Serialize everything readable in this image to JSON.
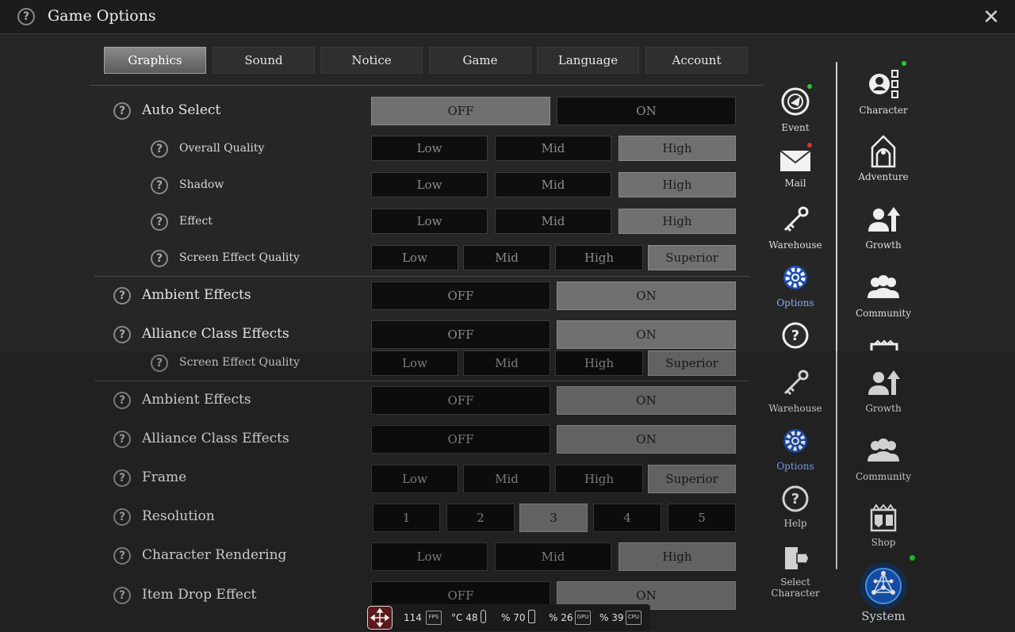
{
  "title": "Game Options",
  "tabs": [
    "Graphics",
    "Sound",
    "Notice",
    "Game",
    "Language",
    "Account"
  ],
  "active_tab": "Graphics",
  "options": {
    "auto_select": {
      "label": "Auto Select",
      "off": "OFF",
      "on": "ON"
    },
    "overall_quality": {
      "label": "Overall Quality",
      "low": "Low",
      "mid": "Mid",
      "high": "High"
    },
    "shadow": {
      "label": "Shadow",
      "low": "Low",
      "mid": "Mid",
      "high": "High"
    },
    "effect": {
      "label": "Effect",
      "low": "Low",
      "mid": "Mid",
      "high": "High"
    },
    "screen_effect_quality": {
      "label": "Screen Effect Quality",
      "low": "Low",
      "mid": "Mid",
      "high": "High",
      "superior": "Superior"
    },
    "ambient_effects": {
      "label": "Ambient Effects",
      "off": "OFF",
      "on": "ON"
    },
    "alliance_class_effects": {
      "label": "Alliance Class Effects",
      "off": "OFF",
      "on": "ON"
    },
    "frame": {
      "label": "Frame",
      "low": "Low",
      "mid": "Mid",
      "high": "High",
      "superior": "Superior"
    },
    "resolution": {
      "label": "Resolution",
      "values": [
        "1",
        "2",
        "3",
        "4",
        "5"
      ]
    },
    "character_rendering": {
      "label": "Character Rendering",
      "low": "Low",
      "mid": "Mid",
      "high": "High"
    },
    "item_drop_effect": {
      "label": "Item Drop Effect",
      "off": "OFF",
      "on": "ON"
    }
  },
  "mid_menu": {
    "event": "Event",
    "mail": "Mail",
    "warehouse": "Warehouse",
    "options": "Options",
    "help": "Help",
    "select_character": "Select Character"
  },
  "right_menu": {
    "character": "Character",
    "adventure": "Adventure",
    "growth": "Growth",
    "community": "Community",
    "shop": "Shop",
    "system": "System"
  },
  "status": {
    "fps": "114",
    "temp": "°C 48",
    "battery": "% 70",
    "gpu": "% 26",
    "cpu": "% 39",
    "fps_chip": "FPS",
    "gpu_chip": "GPU",
    "cpu_chip": "CPU"
  },
  "colors": {
    "selected": "#707070",
    "unselected": "#0e0e0e",
    "notification": "#22cc33",
    "mail_dot": "#e03030",
    "options_accent": "#7fb0ff"
  }
}
